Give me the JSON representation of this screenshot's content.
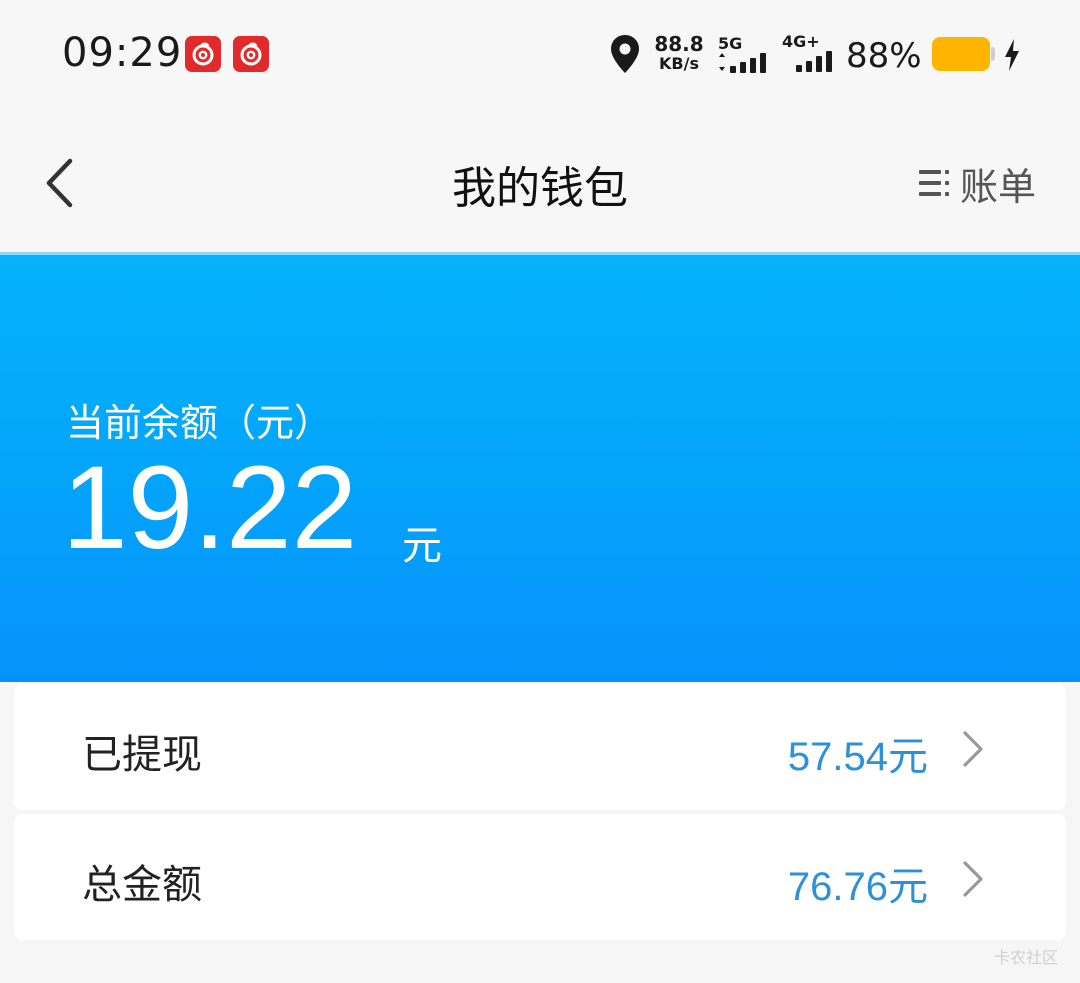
{
  "status_bar": {
    "time": "09:29",
    "net_speed_value": "88.8",
    "net_speed_unit": "KB/s",
    "network_1": "5G",
    "network_2": "4G+",
    "battery_percent": "88%"
  },
  "header": {
    "title": "我的钱包",
    "bill_label": "账单"
  },
  "balance": {
    "label": "当前余额（元）",
    "value": "19.22",
    "unit": "元"
  },
  "rows": [
    {
      "label": "已提现",
      "value": "57.54元"
    },
    {
      "label": "总金额",
      "value": "76.76元"
    }
  ],
  "watermark": "卡农社区",
  "colors": {
    "accent_blue": "#04a7fb",
    "value_blue": "#2e90d8",
    "battery": "#ffb400",
    "app_icon_red": "#e22a2a"
  },
  "icons": [
    "netease-music-icon",
    "location-pin-icon",
    "signal-icon",
    "battery-icon",
    "charging-icon",
    "back-arrow-icon",
    "list-icon",
    "chevron-right-icon"
  ]
}
